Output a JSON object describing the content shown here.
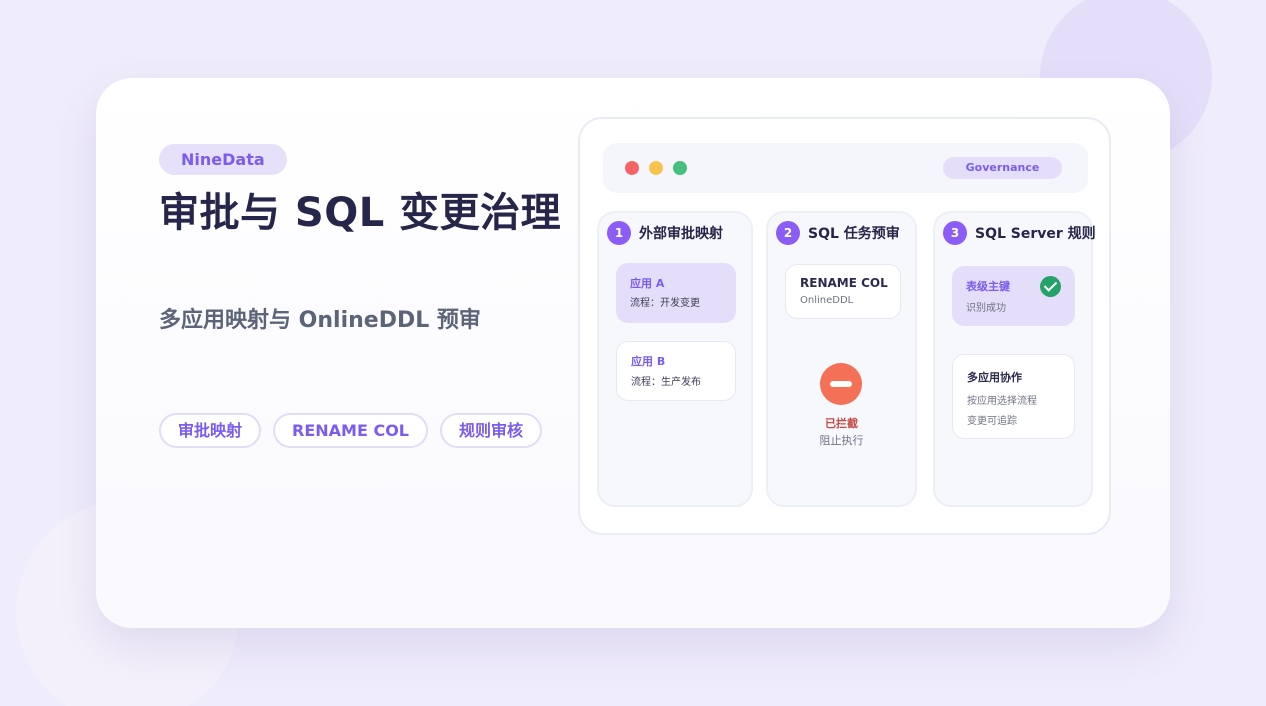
{
  "brand": "NineData",
  "title": "审批与 SQL 变更治理",
  "subtitle": "多应用映射与 OnlineDDL 预审",
  "tags": [
    "审批映射",
    "RENAME COL",
    "规则审核"
  ],
  "panel": {
    "window_badge": "Governance",
    "columns": [
      {
        "number": "1",
        "title": "外部审批映射",
        "items": [
          {
            "title": "应用 A",
            "text": "流程：开发变更"
          },
          {
            "title": "应用 B",
            "text": "流程：生产发布"
          }
        ]
      },
      {
        "number": "2",
        "title": "SQL 任务预审",
        "item": {
          "title": "RENAME COL",
          "text": "OnlineDDL"
        },
        "status": {
          "label": "已拦截",
          "text": "阻止执行"
        }
      },
      {
        "number": "3",
        "title": "SQL Server 规则",
        "items": [
          {
            "title": "表级主键",
            "text": "识别成功"
          },
          {
            "title": "多应用协作",
            "lines": [
              "按应用选择流程",
              "变更可追踪"
            ]
          }
        ]
      }
    ]
  },
  "colors": {
    "accent": "#7b5cf0",
    "blocked": "#f47057",
    "success": "#23a269"
  }
}
